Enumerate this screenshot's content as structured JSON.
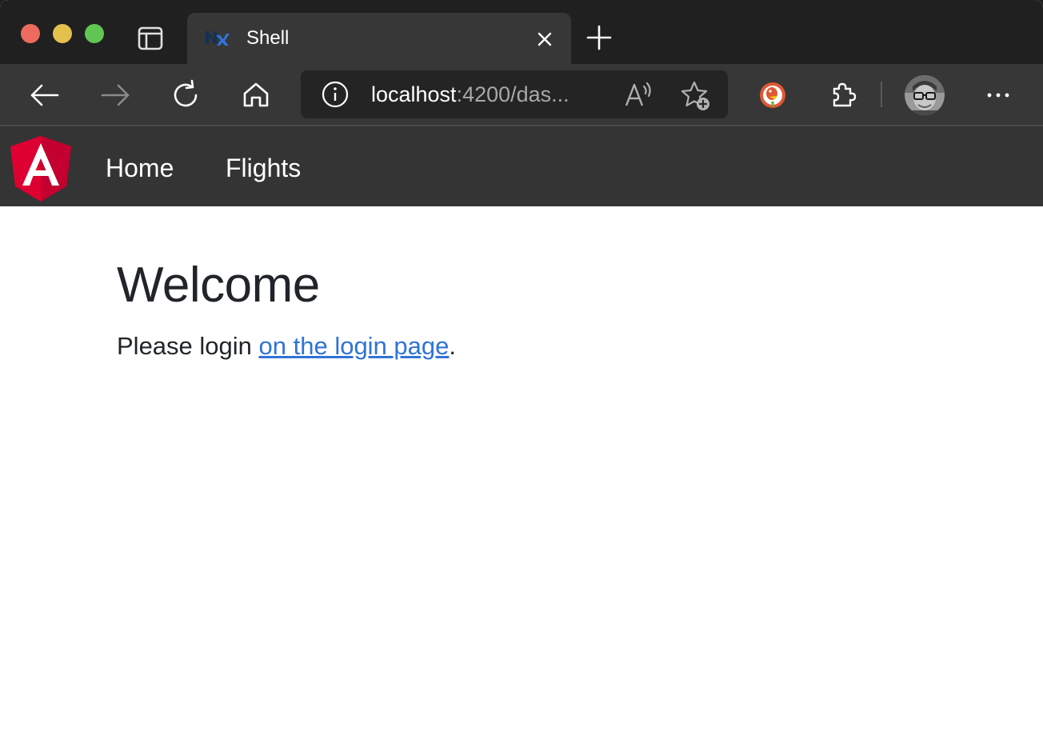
{
  "tab": {
    "title": "Shell",
    "favicon": "nx-favicon-icon"
  },
  "address": {
    "host": "localhost",
    "rest": ":4200/das..."
  },
  "navbar": {
    "logo": "angular-logo-icon",
    "items": [
      {
        "label": "Home"
      },
      {
        "label": "Flights"
      }
    ]
  },
  "page": {
    "title": "Welcome",
    "text_before": "Please login ",
    "link_label": "on the login page",
    "text_after": "."
  },
  "colors": {
    "tabstrip": "#202020",
    "toolbar": "#373737",
    "navbar": "#343434",
    "link": "#2f73d8",
    "angular_red": "#dd0031"
  }
}
